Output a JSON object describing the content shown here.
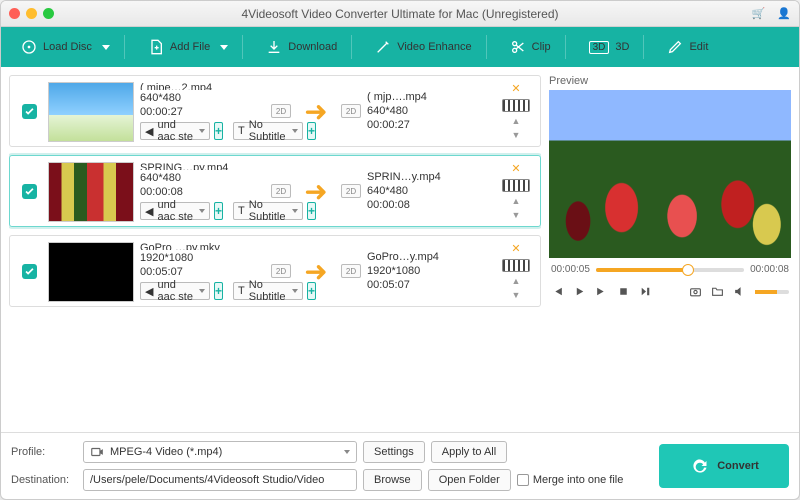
{
  "title": "4Videosoft Video Converter Ultimate for Mac (Unregistered)",
  "toolbar": {
    "loadDisc": "Load Disc",
    "addFile": "Add File",
    "download": "Download",
    "videoEnhance": "Video Enhance",
    "clip": "Clip",
    "threeD": "3D",
    "edit": "Edit"
  },
  "items": [
    {
      "srcName": "( mjpe…2.mp4",
      "srcRes": "640*480",
      "srcDur": "00:00:27",
      "dstName": "( mjp….mp4",
      "dstRes": "640*480",
      "dstDur": "00:00:27",
      "audio": "und aac ste",
      "subtitle": "No Subtitle",
      "thumb": "sky"
    },
    {
      "srcName": "SPRING…py.mp4",
      "srcRes": "640*480",
      "srcDur": "00:00:08",
      "dstName": "SPRIN…y.mp4",
      "dstRes": "640*480",
      "dstDur": "00:00:08",
      "audio": "und aac ste",
      "subtitle": "No Subtitle",
      "thumb": "tulip",
      "selected": true
    },
    {
      "srcName": "GoPro …py.mkv",
      "srcRes": "1920*1080",
      "srcDur": "00:05:07",
      "dstName": "GoPro…y.mp4",
      "dstRes": "1920*1080",
      "dstDur": "00:05:07",
      "audio": "und aac ste",
      "subtitle": "No Subtitle",
      "thumb": "black"
    }
  ],
  "preview": {
    "label": "Preview",
    "current": "00:00:05",
    "total": "00:00:08",
    "progressPct": 62
  },
  "footer": {
    "profileLabel": "Profile:",
    "profileValue": "MPEG-4 Video (*.mp4)",
    "settings": "Settings",
    "applyAll": "Apply to All",
    "destLabel": "Destination:",
    "destValue": "/Users/pele/Documents/4Videosoft Studio/Video",
    "browse": "Browse",
    "openFolder": "Open Folder",
    "merge": "Merge into one file",
    "convert": "Convert"
  },
  "badge2d": "2D",
  "audioIcon": "◀",
  "subIcon": "T"
}
